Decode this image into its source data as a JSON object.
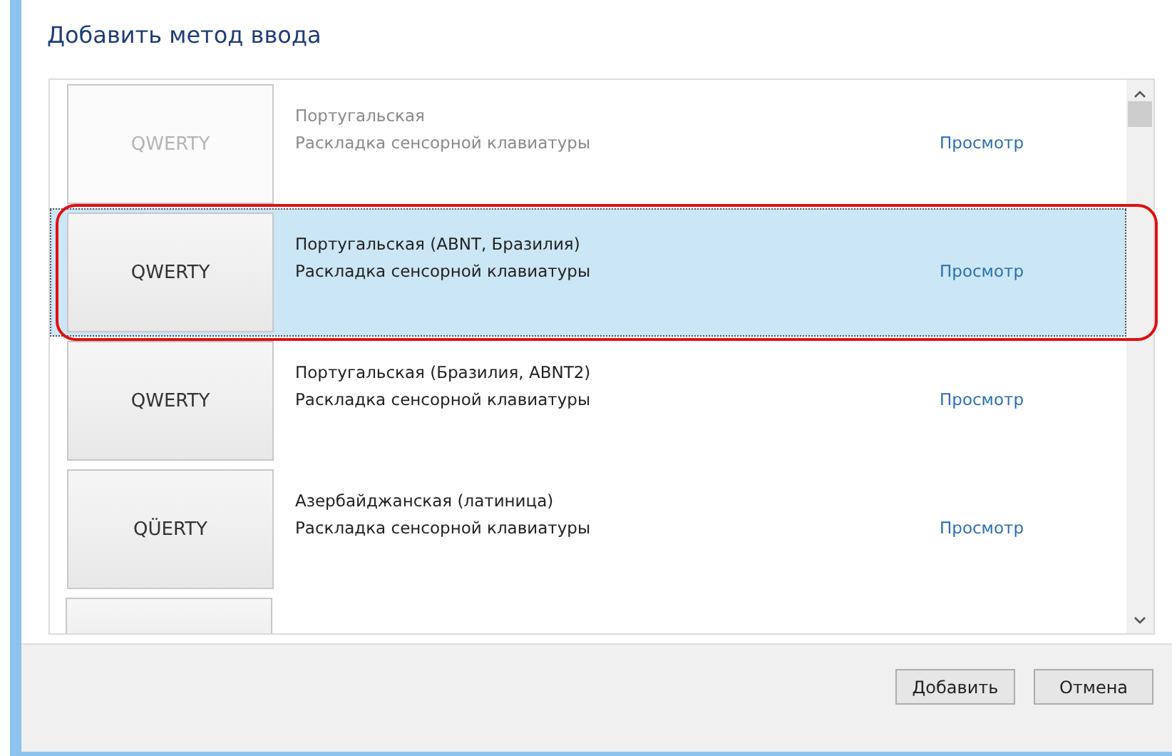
{
  "title": "Добавить метод ввода",
  "methods": [
    {
      "key": "QWERTY",
      "name": "Португальская",
      "description": "Раскладка сенсорной клавиатуры",
      "link": "Просмотр",
      "selected": false,
      "disabled": true,
      "highlighted": false
    },
    {
      "key": "QWERTY",
      "name": "Португальская (ABNT, Бразилия)",
      "description": "Раскладка сенсорной клавиатуры",
      "link": "Просмотр",
      "selected": true,
      "disabled": false,
      "highlighted": true
    },
    {
      "key": "QWERTY",
      "name": "Португальская (Бразилия, ABNT2)",
      "description": "Раскладка сенсорной клавиатуры",
      "link": "Просмотр",
      "selected": false,
      "disabled": false,
      "highlighted": false
    },
    {
      "key": "QÜERTY",
      "name": "Азербайджанская (латиница)",
      "description": "Раскладка сенсорной клавиатуры",
      "link": "Просмотр",
      "selected": false,
      "disabled": false,
      "highlighted": false
    }
  ],
  "buttons": [
    "Добавить",
    "Отмена"
  ]
}
